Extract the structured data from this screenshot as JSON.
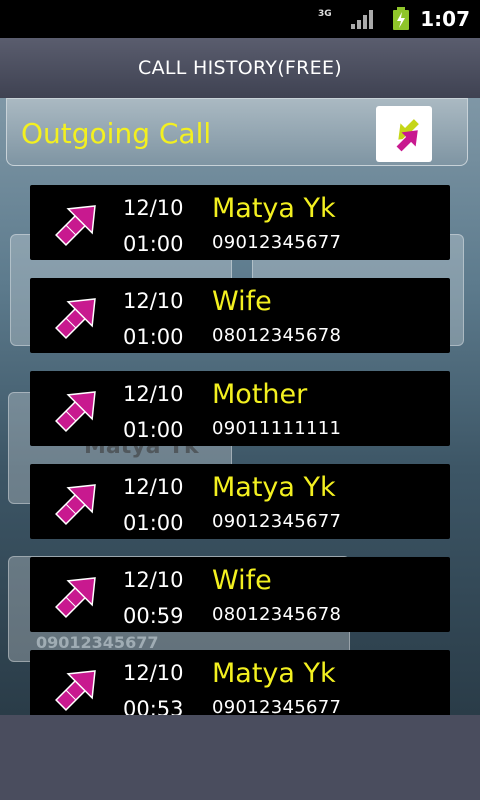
{
  "status": {
    "network": "3G",
    "time": "1:07"
  },
  "title": "CALL HISTORY(FREE)",
  "header": {
    "label": "Outgoing Call"
  },
  "calls": [
    {
      "date": "12/10",
      "time": "01:00",
      "name": "Matya Yk",
      "number": "09012345677"
    },
    {
      "date": "12/10",
      "time": "01:00",
      "name": "Wife",
      "number": "08012345678"
    },
    {
      "date": "12/10",
      "time": "01:00",
      "name": "Mother",
      "number": "09011111111"
    },
    {
      "date": "12/10",
      "time": "01:00",
      "name": "Matya Yk",
      "number": "09012345677"
    },
    {
      "date": "12/10",
      "time": "00:59",
      "name": "Wife",
      "number": "08012345678"
    },
    {
      "date": "12/10",
      "time": "00:53",
      "name": "Matya Yk",
      "number": "09012345677"
    }
  ],
  "background": {
    "ghost_name": "Matya Yk",
    "ghost_number": "09012345677"
  },
  "colors": {
    "accent_yellow": "#f3f020",
    "arrow_magenta": "#c8198f",
    "row_bg": "#000000"
  },
  "icons": {
    "row": "outgoing-call-arrow-icon",
    "toggle": "call-direction-toggle-icon"
  }
}
